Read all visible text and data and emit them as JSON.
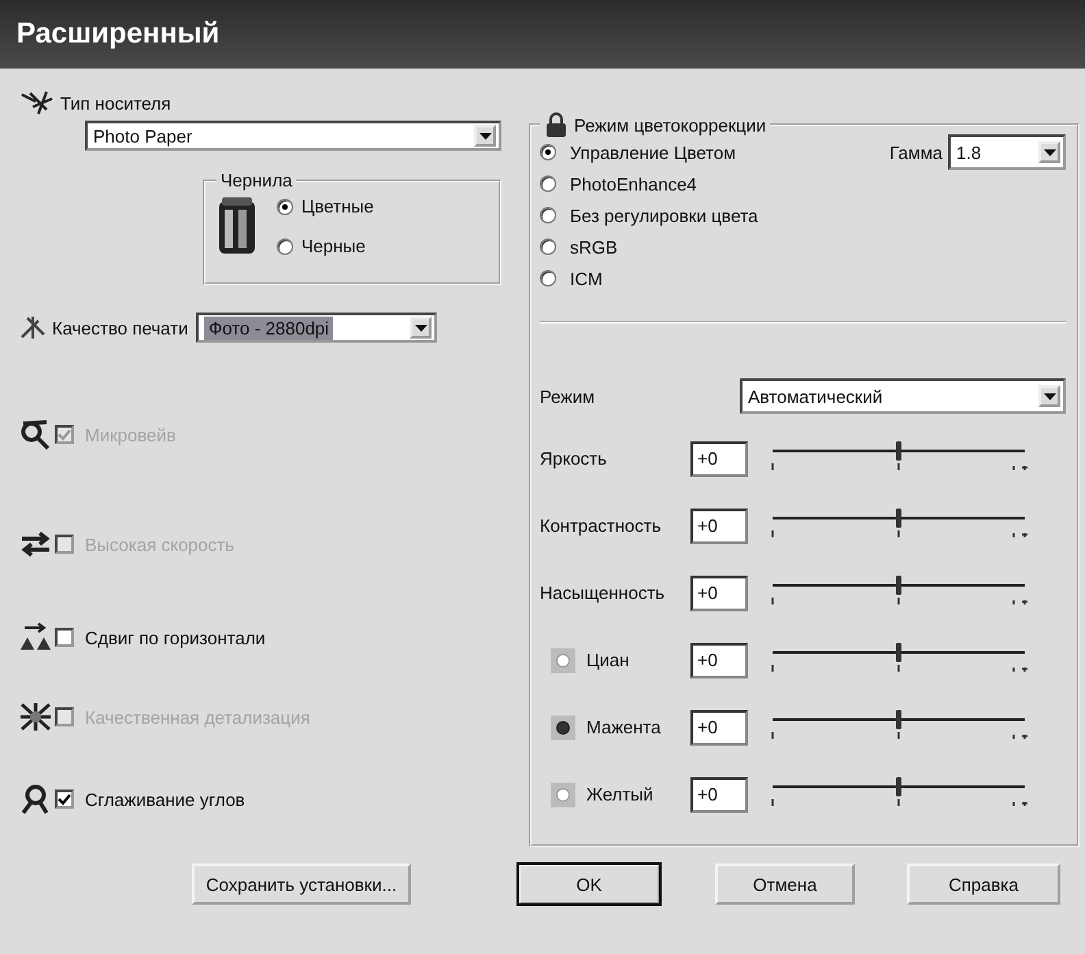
{
  "window": {
    "title": "Расширенный"
  },
  "media_type": {
    "label": "Тип носителя",
    "value": "Photo Paper"
  },
  "ink": {
    "title": "Чернила",
    "options": [
      {
        "label": "Цветные",
        "selected": true
      },
      {
        "label": "Черные",
        "selected": false
      }
    ]
  },
  "print_quality": {
    "label": "Качество печати",
    "value": "Фото - 2880dpi"
  },
  "options": [
    {
      "label": "Микровейв",
      "checked": true,
      "disabled": true
    },
    {
      "label": "Высокая скорость",
      "checked": false,
      "disabled": true
    },
    {
      "label": "Сдвиг по горизонтали",
      "checked": false,
      "disabled": false
    },
    {
      "label": "Качественная детализация",
      "checked": false,
      "disabled": true
    },
    {
      "label": "Сглаживание углов",
      "checked": true,
      "disabled": false
    }
  ],
  "color_management": {
    "title": "Режим цветокоррекции",
    "modes": [
      {
        "label": "Управление Цветом",
        "selected": true
      },
      {
        "label": "PhotoEnhance4",
        "selected": false
      },
      {
        "label": "Без регулировки цвета",
        "selected": false
      },
      {
        "label": "sRGB",
        "selected": false
      },
      {
        "label": "ICM",
        "selected": false
      }
    ],
    "gamma": {
      "label": "Гамма",
      "value": "1.8"
    },
    "mode": {
      "label": "Режим",
      "value": "Автоматический"
    },
    "adjustments": [
      {
        "label": "Яркость",
        "value": "+0",
        "level": 0.5
      },
      {
        "label": "Контрастность",
        "value": "+0",
        "level": 0.5
      },
      {
        "label": "Насыщенность",
        "value": "+0",
        "level": 0.5
      }
    ],
    "channels": [
      {
        "label": "Циан",
        "value": "+0",
        "level": 0.5,
        "selected": false
      },
      {
        "label": "Мажента",
        "value": "+0",
        "level": 0.5,
        "selected": true
      },
      {
        "label": "Желтый",
        "value": "+0",
        "level": 0.5,
        "selected": false
      }
    ]
  },
  "buttons": [
    {
      "label": "Сохранить установки...",
      "default": false
    },
    {
      "label": "OK",
      "default": true
    },
    {
      "label": "Отмена",
      "default": false
    },
    {
      "label": "Справка",
      "default": false
    }
  ]
}
